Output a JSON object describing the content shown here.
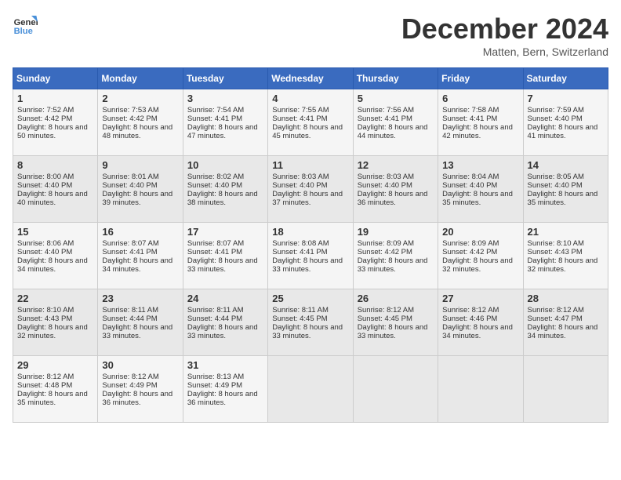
{
  "logo": {
    "line1": "General",
    "line2": "Blue"
  },
  "title": "December 2024",
  "location": "Matten, Bern, Switzerland",
  "days_of_week": [
    "Sunday",
    "Monday",
    "Tuesday",
    "Wednesday",
    "Thursday",
    "Friday",
    "Saturday"
  ],
  "weeks": [
    [
      {
        "day": "1",
        "sunrise": "7:52 AM",
        "sunset": "4:42 PM",
        "daylight": "8 hours and 50 minutes."
      },
      {
        "day": "2",
        "sunrise": "7:53 AM",
        "sunset": "4:42 PM",
        "daylight": "8 hours and 48 minutes."
      },
      {
        "day": "3",
        "sunrise": "7:54 AM",
        "sunset": "4:41 PM",
        "daylight": "8 hours and 47 minutes."
      },
      {
        "day": "4",
        "sunrise": "7:55 AM",
        "sunset": "4:41 PM",
        "daylight": "8 hours and 45 minutes."
      },
      {
        "day": "5",
        "sunrise": "7:56 AM",
        "sunset": "4:41 PM",
        "daylight": "8 hours and 44 minutes."
      },
      {
        "day": "6",
        "sunrise": "7:58 AM",
        "sunset": "4:41 PM",
        "daylight": "8 hours and 42 minutes."
      },
      {
        "day": "7",
        "sunrise": "7:59 AM",
        "sunset": "4:40 PM",
        "daylight": "8 hours and 41 minutes."
      }
    ],
    [
      {
        "day": "8",
        "sunrise": "8:00 AM",
        "sunset": "4:40 PM",
        "daylight": "8 hours and 40 minutes."
      },
      {
        "day": "9",
        "sunrise": "8:01 AM",
        "sunset": "4:40 PM",
        "daylight": "8 hours and 39 minutes."
      },
      {
        "day": "10",
        "sunrise": "8:02 AM",
        "sunset": "4:40 PM",
        "daylight": "8 hours and 38 minutes."
      },
      {
        "day": "11",
        "sunrise": "8:03 AM",
        "sunset": "4:40 PM",
        "daylight": "8 hours and 37 minutes."
      },
      {
        "day": "12",
        "sunrise": "8:03 AM",
        "sunset": "4:40 PM",
        "daylight": "8 hours and 36 minutes."
      },
      {
        "day": "13",
        "sunrise": "8:04 AM",
        "sunset": "4:40 PM",
        "daylight": "8 hours and 35 minutes."
      },
      {
        "day": "14",
        "sunrise": "8:05 AM",
        "sunset": "4:40 PM",
        "daylight": "8 hours and 35 minutes."
      }
    ],
    [
      {
        "day": "15",
        "sunrise": "8:06 AM",
        "sunset": "4:40 PM",
        "daylight": "8 hours and 34 minutes."
      },
      {
        "day": "16",
        "sunrise": "8:07 AM",
        "sunset": "4:41 PM",
        "daylight": "8 hours and 34 minutes."
      },
      {
        "day": "17",
        "sunrise": "8:07 AM",
        "sunset": "4:41 PM",
        "daylight": "8 hours and 33 minutes."
      },
      {
        "day": "18",
        "sunrise": "8:08 AM",
        "sunset": "4:41 PM",
        "daylight": "8 hours and 33 minutes."
      },
      {
        "day": "19",
        "sunrise": "8:09 AM",
        "sunset": "4:42 PM",
        "daylight": "8 hours and 33 minutes."
      },
      {
        "day": "20",
        "sunrise": "8:09 AM",
        "sunset": "4:42 PM",
        "daylight": "8 hours and 32 minutes."
      },
      {
        "day": "21",
        "sunrise": "8:10 AM",
        "sunset": "4:43 PM",
        "daylight": "8 hours and 32 minutes."
      }
    ],
    [
      {
        "day": "22",
        "sunrise": "8:10 AM",
        "sunset": "4:43 PM",
        "daylight": "8 hours and 32 minutes."
      },
      {
        "day": "23",
        "sunrise": "8:11 AM",
        "sunset": "4:44 PM",
        "daylight": "8 hours and 33 minutes."
      },
      {
        "day": "24",
        "sunrise": "8:11 AM",
        "sunset": "4:44 PM",
        "daylight": "8 hours and 33 minutes."
      },
      {
        "day": "25",
        "sunrise": "8:11 AM",
        "sunset": "4:45 PM",
        "daylight": "8 hours and 33 minutes."
      },
      {
        "day": "26",
        "sunrise": "8:12 AM",
        "sunset": "4:45 PM",
        "daylight": "8 hours and 33 minutes."
      },
      {
        "day": "27",
        "sunrise": "8:12 AM",
        "sunset": "4:46 PM",
        "daylight": "8 hours and 34 minutes."
      },
      {
        "day": "28",
        "sunrise": "8:12 AM",
        "sunset": "4:47 PM",
        "daylight": "8 hours and 34 minutes."
      }
    ],
    [
      {
        "day": "29",
        "sunrise": "8:12 AM",
        "sunset": "4:48 PM",
        "daylight": "8 hours and 35 minutes."
      },
      {
        "day": "30",
        "sunrise": "8:12 AM",
        "sunset": "4:49 PM",
        "daylight": "8 hours and 36 minutes."
      },
      {
        "day": "31",
        "sunrise": "8:13 AM",
        "sunset": "4:49 PM",
        "daylight": "8 hours and 36 minutes."
      },
      null,
      null,
      null,
      null
    ]
  ]
}
